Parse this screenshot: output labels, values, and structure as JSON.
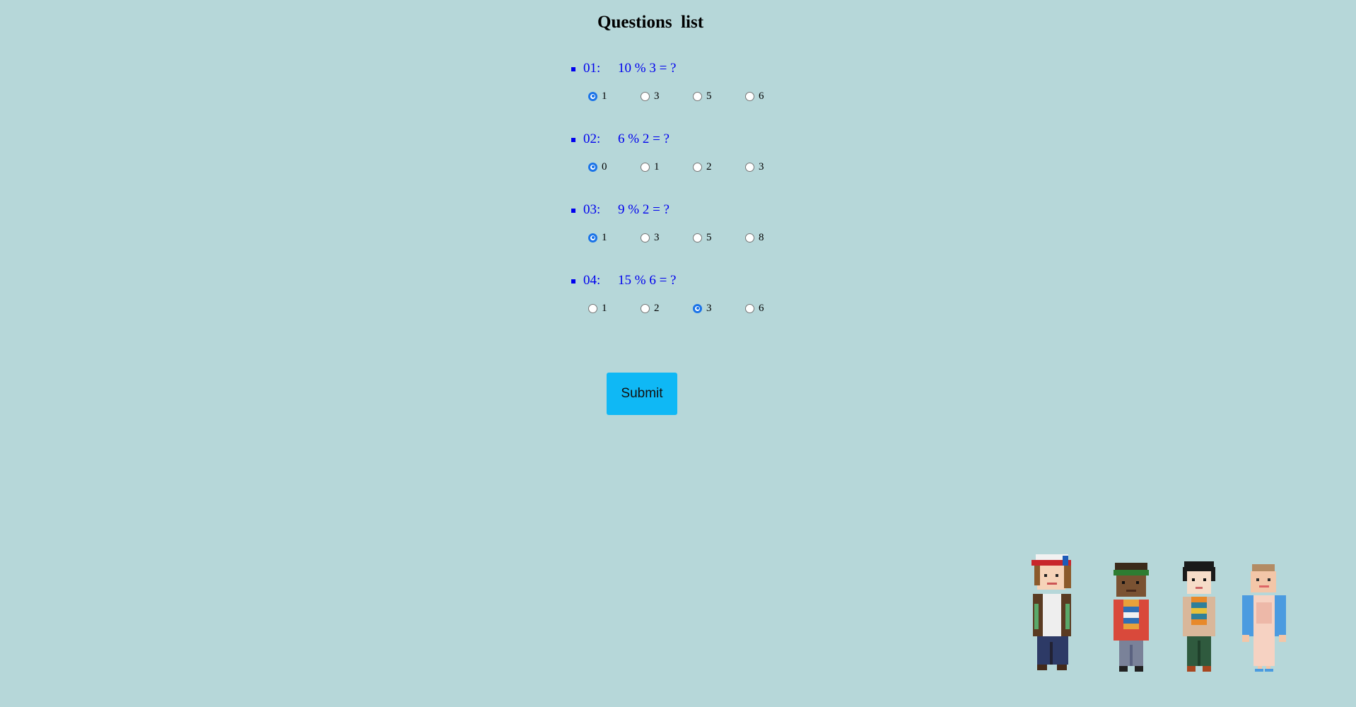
{
  "page": {
    "title": "Questions  list"
  },
  "questions": [
    {
      "number": "01:",
      "text": "10 % 3 = ?",
      "options": [
        "1",
        "3",
        "5",
        "6"
      ],
      "selected": 0
    },
    {
      "number": "02:",
      "text": "6 % 2 = ?",
      "options": [
        "0",
        "1",
        "2",
        "3"
      ],
      "selected": 0
    },
    {
      "number": "03:",
      "text": "9 % 2 = ?",
      "options": [
        "1",
        "3",
        "5",
        "8"
      ],
      "selected": 0
    },
    {
      "number": "04:",
      "text": "15 % 6 = ?",
      "options": [
        "1",
        "2",
        "3",
        "6"
      ],
      "selected": 2
    }
  ],
  "actions": {
    "submit_label": "Submit"
  },
  "colors": {
    "background": "#b6d7d9",
    "question_text": "#0000ee",
    "submit_button": "#0fb8f5",
    "radio_selected": "#1a73e8"
  },
  "characters": [
    "dustin-character",
    "lucas-character",
    "mike-character",
    "eleven-character"
  ]
}
